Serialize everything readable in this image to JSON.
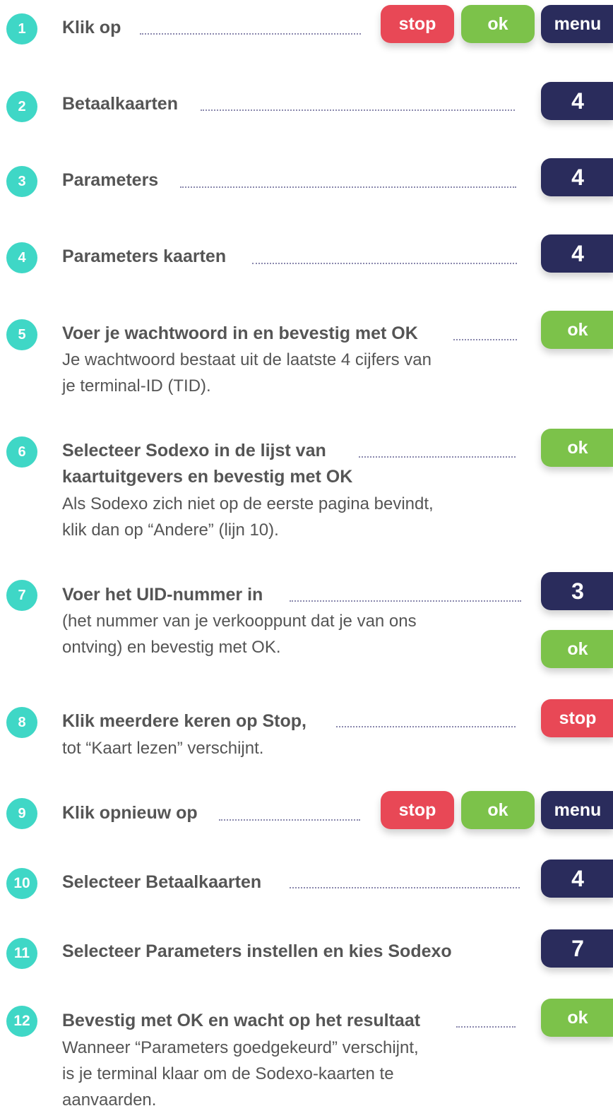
{
  "steps": [
    {
      "number": "1",
      "title": "Klik op",
      "buttons": [
        "stop",
        "ok",
        "menu"
      ]
    },
    {
      "number": "2",
      "title": "Betaalkaarten",
      "buttons": [
        "4"
      ]
    },
    {
      "number": "3",
      "title": "Parameters",
      "buttons": [
        "4"
      ]
    },
    {
      "number": "4",
      "title": "Parameters kaarten",
      "buttons": [
        "4"
      ]
    },
    {
      "number": "5",
      "title": "Voer je wachtwoord in en bevestig met OK",
      "description_lines": [
        "Je wachtwoord bestaat uit de laatste 4 cijfers van",
        "je terminal-ID (TID)."
      ],
      "buttons": [
        "ok"
      ]
    },
    {
      "number": "6",
      "title_lines": [
        "Selecteer Sodexo in de lijst van",
        "kaartuitgevers en bevestig met OK"
      ],
      "description_lines": [
        "Als Sodexo zich niet op de eerste pagina bevindt,",
        "klik dan op “Andere” (lijn 10)."
      ],
      "buttons": [
        "ok"
      ]
    },
    {
      "number": "7",
      "title": "Voer het UID-nummer in",
      "description_lines": [
        "(het nummer van je verkooppunt dat je van ons",
        "ontving) en bevestig met OK."
      ],
      "buttons": [
        "3",
        "ok"
      ]
    },
    {
      "number": "8",
      "title": "Klik meerdere keren op Stop,",
      "description_lines": [
        "tot “Kaart lezen” verschijnt."
      ],
      "buttons": [
        "stop"
      ]
    },
    {
      "number": "9",
      "title": "Klik opnieuw op",
      "buttons": [
        "stop",
        "ok",
        "menu"
      ]
    },
    {
      "number": "10",
      "title": "Selecteer Betaalkaarten",
      "buttons": [
        "4"
      ]
    },
    {
      "number": "11",
      "title": "Selecteer Parameters instellen en kies Sodexo",
      "buttons": [
        "7"
      ]
    },
    {
      "number": "12",
      "title": "Bevestig met OK en wacht op het resultaat",
      "description_lines": [
        "Wanneer “Parameters goedgekeurd” verschijnt,",
        "is je terminal klaar om de Sodexo-kaarten te",
        "aanvaarden."
      ],
      "buttons": [
        "ok"
      ]
    }
  ],
  "colors": {
    "step_badge": "#3fd7c6",
    "stop_key": "#e84856",
    "ok_key": "#7cc24a",
    "menu_key": "#2a2c5c",
    "text": "#555555"
  }
}
